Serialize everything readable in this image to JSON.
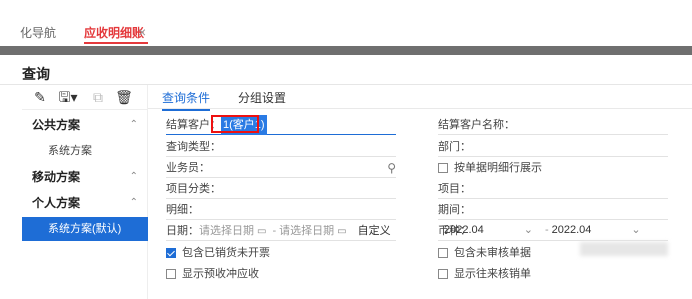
{
  "tabs": {
    "nav": "化导航",
    "active": "应收明细账",
    "close": "×"
  },
  "dialog": {
    "title": "查询"
  },
  "left_panel": {
    "tools": [
      "edit-icon",
      "save-icon",
      "export-icon",
      "delete-icon"
    ],
    "groups": [
      {
        "label": "公共方案",
        "items": [
          "系统方案"
        ]
      },
      {
        "label": "移动方案",
        "items": []
      },
      {
        "label": "个人方案",
        "items": [
          "系统方案(默认)"
        ]
      }
    ]
  },
  "right_panel": {
    "tabs": [
      "查询条件",
      "分组设置"
    ],
    "col1": {
      "settle_customer_label": "结算客户：",
      "settle_customer_value": "1(客户1)",
      "query_type_label": "查询类型：",
      "salesperson_label": "业务员：",
      "project_category_label": "项目分类：",
      "detail_label": "明细：",
      "date_label": "日期：",
      "date_from_placeholder": "请选择日期",
      "date_to_placeholder": "请选择日期",
      "date_dash": "-",
      "date_custom": "自定义",
      "include_sold_uninvoiced": "包含已销货未开票",
      "show_prepaid_offset": "显示预收冲应收"
    },
    "col2": {
      "settle_customer_name_label": "结算客户名称：",
      "department_label": "部门：",
      "expand_by_doc_detail": "按单据明细行展示",
      "project_label": "项目：",
      "period_label": "期间：",
      "period_from": "2022.04",
      "period_to": "2022.04",
      "period_dash": "-",
      "currency_label": "币种：",
      "include_unaudited": "包含未审核单据",
      "show_contacts_verification": "显示往来核销单"
    }
  },
  "colors": {
    "accent": "#1e6dd6",
    "active_tab": "#e4393c",
    "highlight": "#e11"
  }
}
